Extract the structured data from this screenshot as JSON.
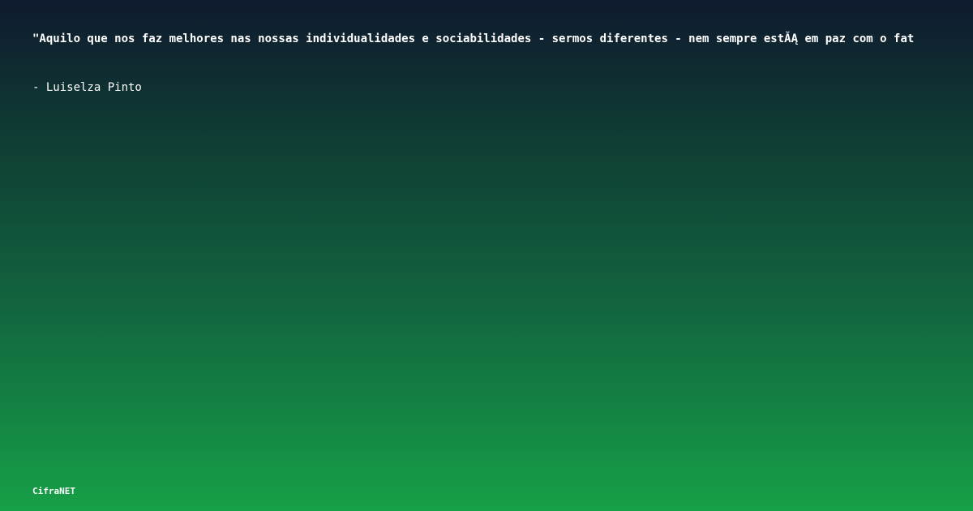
{
  "quote": {
    "text": "\"Aquilo que nos faz melhores nas nossas individualidades e sociabilidades - sermos diferentes - nem sempre estĂĄ em paz com o fat"
  },
  "author": {
    "line": "- Luiselza Pinto"
  },
  "brand": {
    "name": "CifraNET"
  },
  "colors": {
    "gradient_top": "#0f1a2e",
    "gradient_bottom": "#16a047",
    "text": "#ffffff"
  }
}
